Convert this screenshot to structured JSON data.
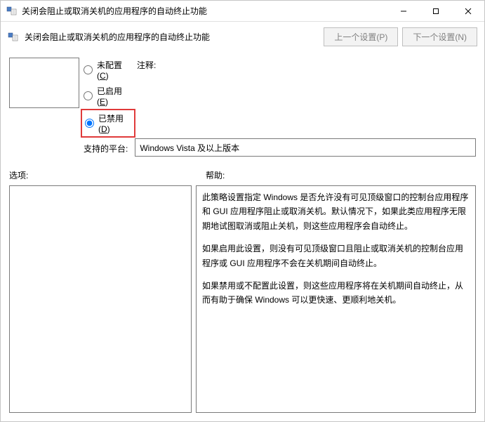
{
  "titlebar": {
    "title": "关闭会阻止或取消关机的应用程序的自动终止功能",
    "minimize": "—",
    "maximize": "☐",
    "close": "✕"
  },
  "subheader": {
    "title": "关闭会阻止或取消关机的应用程序的自动终止功能",
    "prev": "上一个设置(P)",
    "next": "下一个设置(N)"
  },
  "radios": {
    "not_configured": "未配置(",
    "not_configured_key": "C",
    "enabled": "已启用(",
    "enabled_key": "E",
    "disabled": "已禁用(",
    "disabled_key": "D",
    "paren_close": ")"
  },
  "labels": {
    "comment": "注释:",
    "platform": "支持的平台:",
    "options": "选项:",
    "help": "帮助:"
  },
  "platform_value": "Windows Vista 及以上版本",
  "help_text": {
    "p1": "此策略设置指定 Windows 是否允许没有可见顶级窗口的控制台应用程序和 GUI 应用程序阻止或取消关机。默认情况下，如果此类应用程序无限期地试图取消或阻止关机，则这些应用程序会自动终止。",
    "p2": "如果启用此设置，则没有可见顶级窗口且阻止或取消关机的控制台应用程序或 GUI 应用程序不会在关机期间自动终止。",
    "p3": "如果禁用或不配置此设置，则这些应用程序将在关机期间自动终止，从而有助于确保 Windows 可以更快速、更顺利地关机。"
  }
}
